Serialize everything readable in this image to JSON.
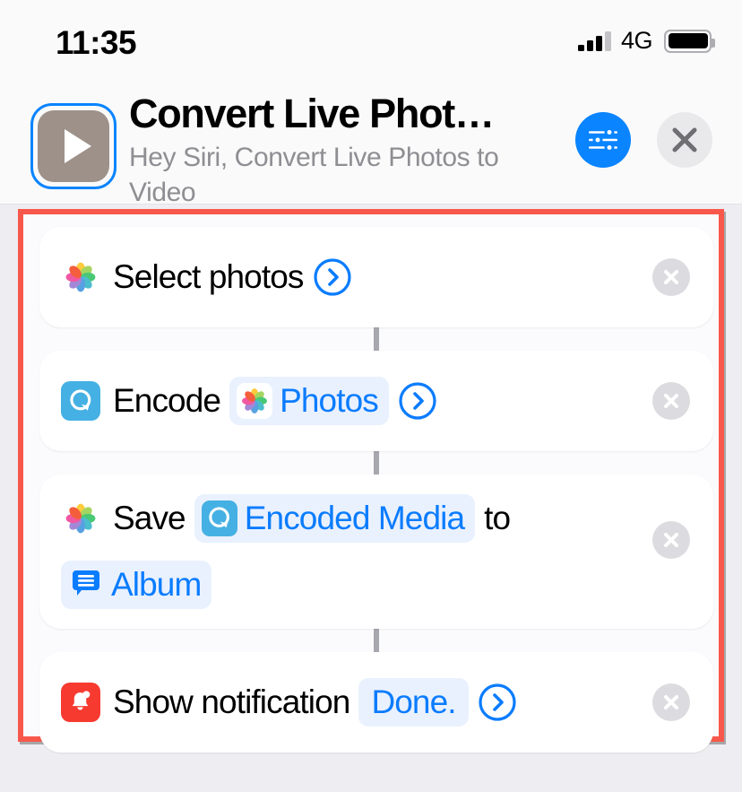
{
  "status_bar": {
    "time": "11:35",
    "network": "4G",
    "signal_bars_filled": 3,
    "signal_bars_total": 4,
    "battery_full": true
  },
  "header": {
    "title": "Convert Live Phot…",
    "subtitle": "Hey Siri, Convert Live Photos to Video",
    "icon": "play-triangle-icon",
    "icon_bg_color": "#9d9189",
    "settings_button": {
      "name": "sliders-icon",
      "color": "#0a84ff"
    },
    "close_button": {
      "name": "close-x-icon",
      "color": "#e9e9ec"
    }
  },
  "highlight": {
    "color": "#f8584b"
  },
  "actions": [
    {
      "app_icon": "photos-icon",
      "label": "Select photos",
      "tokens": [],
      "has_chevron": true,
      "has_remove": true,
      "trailing_text": ""
    },
    {
      "app_icon": "media-q-icon",
      "label": "Encode",
      "tokens": [
        {
          "icon": "photos-icon",
          "text": "Photos"
        }
      ],
      "has_chevron": true,
      "has_remove": true,
      "trailing_text": ""
    },
    {
      "app_icon": "photos-icon",
      "label": "Save",
      "tokens": [
        {
          "icon": "media-q-icon",
          "text": "Encoded Media"
        },
        {
          "icon": "text-bubble-icon",
          "text": "Album"
        }
      ],
      "has_chevron": false,
      "has_remove": true,
      "trailing_text": "to"
    },
    {
      "app_icon": "bell-icon",
      "label": "Show notification",
      "tokens": [
        {
          "icon": "",
          "text": "Done."
        }
      ],
      "has_chevron": true,
      "has_remove": true,
      "trailing_text": ""
    }
  ],
  "colors": {
    "accent_blue": "#0a7cff",
    "token_bg": "#e9f1fe",
    "page_bg": "#eeeef2",
    "card_bg": "#ffffff",
    "connector": "#a7a7af",
    "subtitle_grey": "#8e8e93"
  }
}
